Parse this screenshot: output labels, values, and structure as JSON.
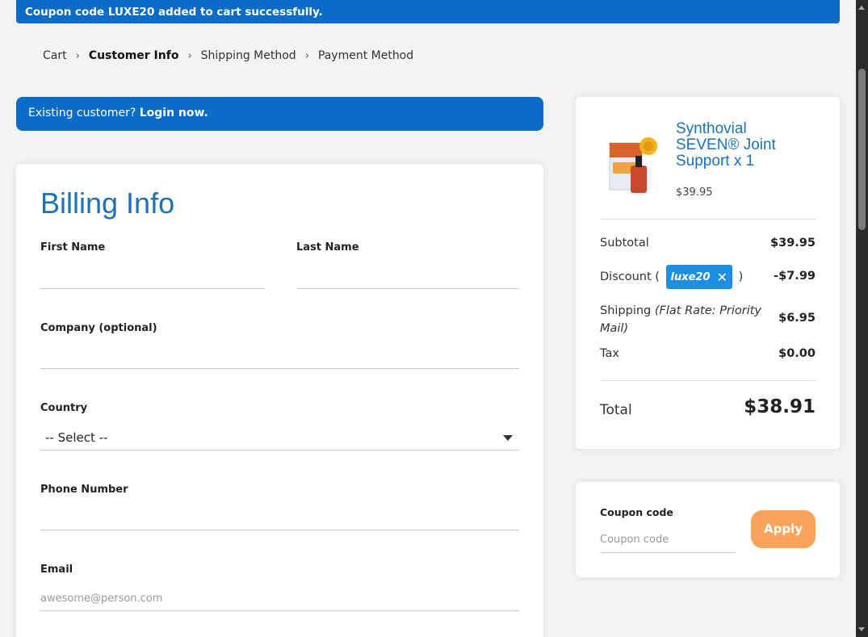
{
  "notice": "Coupon code LUXE20 added to cart successfully.",
  "breadcrumb": {
    "items": [
      "Cart",
      "Customer Info",
      "Shipping Method",
      "Payment Method"
    ],
    "separator": "›"
  },
  "login_banner": {
    "prefix": "Existing customer?",
    "link": "Login now."
  },
  "billing": {
    "title": "Billing Info",
    "first_name_label": "First Name",
    "last_name_label": "Last Name",
    "company_label": "Company (optional)",
    "country_label": "Country",
    "country_value": "-- Select --",
    "phone_label": "Phone Number",
    "email_label": "Email",
    "email_placeholder": "awesome@person.com"
  },
  "summary": {
    "product_title": "Synthovial SEVEN® Joint Support x 1",
    "product_price": "$39.95",
    "subtotal_label": "Subtotal",
    "subtotal_value": "$39.95",
    "discount_label": "Discount (",
    "discount_close": ")",
    "coupon_tag": "luxe20",
    "discount_value": "-$7.99",
    "shipping_label": "Shipping",
    "shipping_method": "(Flat Rate: Priority Mail)",
    "shipping_value": "$6.95",
    "tax_label": "Tax",
    "tax_value": "$0.00",
    "total_label": "Total",
    "total_value": "$38.91"
  },
  "coupon": {
    "label": "Coupon code",
    "placeholder": "Coupon code",
    "apply_label": "Apply"
  },
  "colors": {
    "primary": "#0a6cc7",
    "title": "#1a73b8",
    "apply": "#f9a45a",
    "tag": "#1c8fe0"
  }
}
